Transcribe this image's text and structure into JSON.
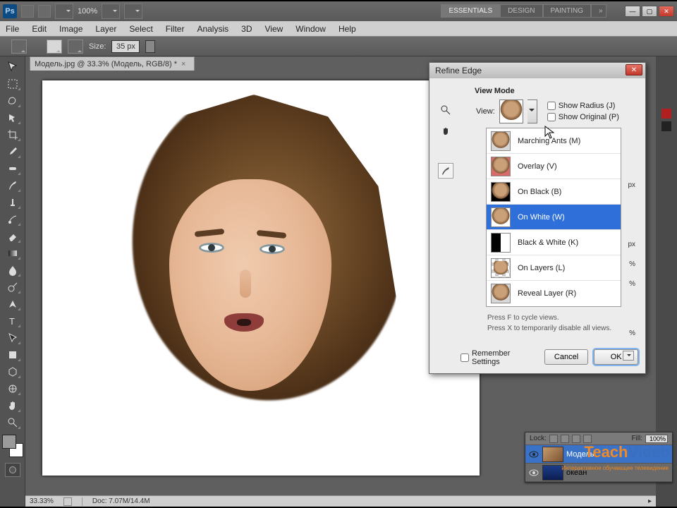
{
  "titlebar": {
    "zoom": "100%",
    "workspaces": [
      "ESSENTIALS",
      "DESIGN",
      "PAINTING"
    ],
    "ws_more": "»"
  },
  "menus": [
    "File",
    "Edit",
    "Image",
    "Layer",
    "Select",
    "Filter",
    "Analysis",
    "3D",
    "View",
    "Window",
    "Help"
  ],
  "options": {
    "size_label": "Size:",
    "size_value": "35 px"
  },
  "doc_tab": {
    "title": "Модель.jpg @ 33.3% (Модель, RGB/8) *"
  },
  "statusbar": {
    "zoom": "33.33%",
    "doc_info": "Doc: 7.07M/14.4M"
  },
  "dialog": {
    "title": "Refine Edge",
    "group_viewmode": "View Mode",
    "view_label": "View:",
    "show_radius": "Show Radius (J)",
    "show_original": "Show Original (P)",
    "items": [
      {
        "label": "Marching Ants (M)"
      },
      {
        "label": "Overlay (V)"
      },
      {
        "label": "On Black (B)"
      },
      {
        "label": "On White (W)"
      },
      {
        "label": "Black & White (K)"
      },
      {
        "label": "On Layers (L)"
      },
      {
        "label": "Reveal Layer (R)"
      }
    ],
    "hint1": "Press F to cycle views.",
    "hint2": "Press X to temporarily disable all views.",
    "remember": "Remember Settings",
    "cancel": "Cancel",
    "ok": "OK",
    "units": {
      "px1": "px",
      "px2": "px",
      "pct1": "%",
      "pct2": "%",
      "pct3": "%"
    }
  },
  "layers": {
    "lock_label": "Lock:",
    "fill_label": "Fill:",
    "fill_value": "100%",
    "rows": [
      {
        "name": "Модель"
      },
      {
        "name": "океан"
      }
    ]
  },
  "watermark": {
    "brand_a": "Teach",
    "brand_b": "Video",
    "sub": "Интерактивное обучающее телевидение"
  }
}
